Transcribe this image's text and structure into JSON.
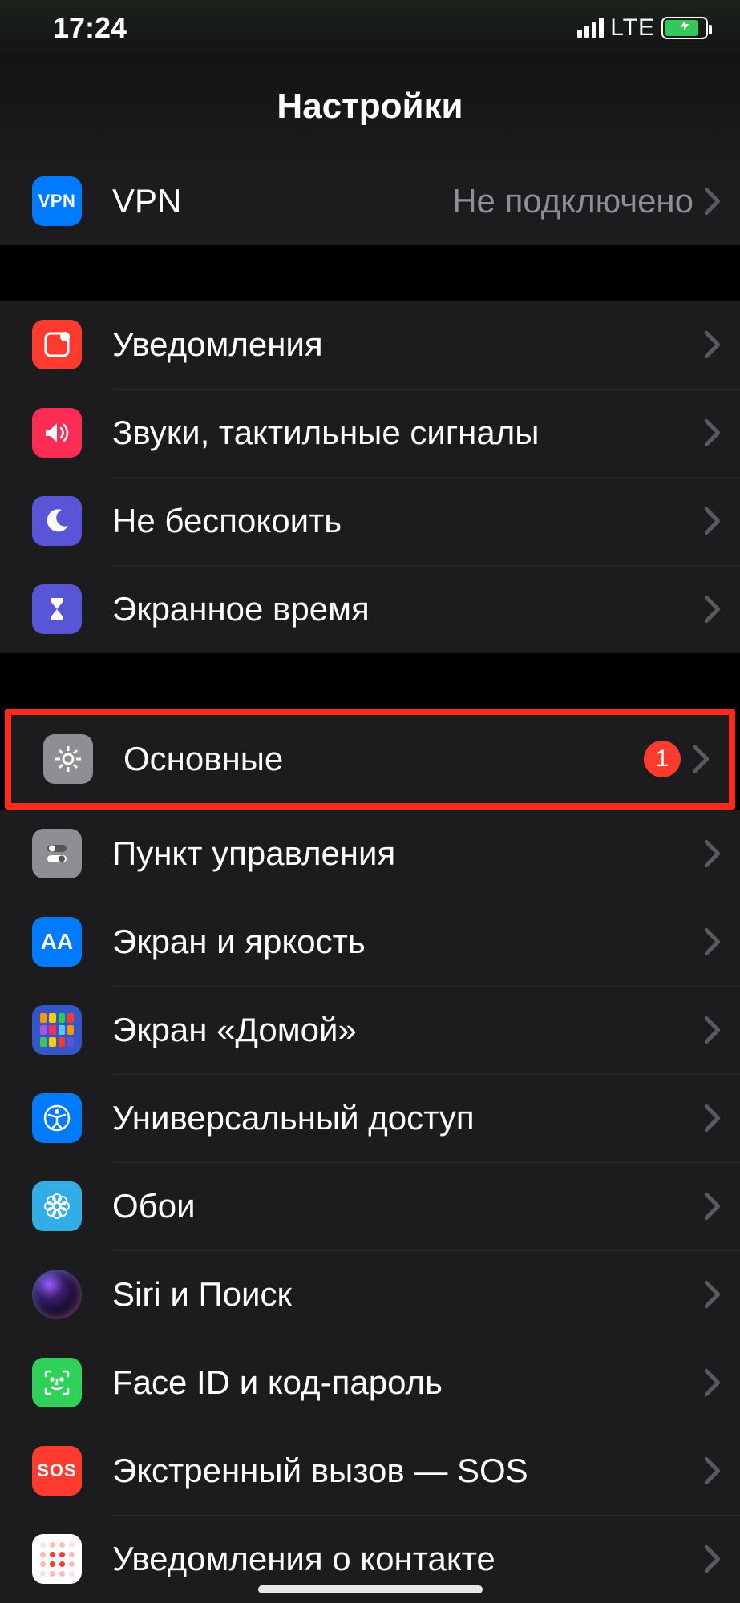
{
  "status": {
    "time": "17:24",
    "network_label": "LTE"
  },
  "header": {
    "title": "Настройки"
  },
  "groups": [
    {
      "id": "connectivity",
      "rows": [
        {
          "id": "vpn",
          "label": "VPN",
          "value": "Не подключено",
          "icon": "vpn-icon",
          "icon_text": "VPN",
          "icon_bg": "bg-blue"
        }
      ]
    },
    {
      "id": "alerts",
      "rows": [
        {
          "id": "notifications",
          "label": "Уведомления",
          "icon": "notifications-icon",
          "icon_bg": "bg-red"
        },
        {
          "id": "sounds",
          "label": "Звуки, тактильные сигналы",
          "icon": "sounds-icon",
          "icon_bg": "bg-pink"
        },
        {
          "id": "dnd",
          "label": "Не беспокоить",
          "icon": "moon-icon",
          "icon_bg": "bg-purple"
        },
        {
          "id": "screentime",
          "label": "Экранное время",
          "icon": "hourglass-icon",
          "icon_bg": "bg-purple"
        }
      ]
    },
    {
      "id": "system",
      "rows": [
        {
          "id": "general",
          "label": "Основные",
          "badge": "1",
          "icon": "gear-icon",
          "icon_bg": "bg-gray",
          "highlighted": true
        },
        {
          "id": "control-center",
          "label": "Пункт управления",
          "icon": "switches-icon",
          "icon_bg": "bg-gray"
        },
        {
          "id": "display",
          "label": "Экран и яркость",
          "icon": "text-size-icon",
          "icon_text": "AA",
          "icon_bg": "bg-blue"
        },
        {
          "id": "home-screen",
          "label": "Экран «Домой»",
          "icon": "home-grid-icon",
          "icon_bg": "bg-darkblue"
        },
        {
          "id": "accessibility",
          "label": "Универсальный доступ",
          "icon": "accessibility-icon",
          "icon_bg": "bg-blue"
        },
        {
          "id": "wallpaper",
          "label": "Обои",
          "icon": "flower-icon",
          "icon_bg": "bg-teal"
        },
        {
          "id": "siri",
          "label": "Siri и Поиск",
          "icon": "siri-icon",
          "icon_bg": "bg-black"
        },
        {
          "id": "faceid",
          "label": "Face ID и код-пароль",
          "icon": "faceid-icon",
          "icon_bg": "bg-green"
        },
        {
          "id": "sos",
          "label": "Экстренный вызов — SOS",
          "icon": "sos-icon",
          "icon_text": "SOS",
          "icon_bg": "bg-red"
        },
        {
          "id": "exposure",
          "label": "Уведомления о контакте",
          "icon": "exposure-icon",
          "icon_bg": "exposure-box"
        }
      ]
    }
  ]
}
